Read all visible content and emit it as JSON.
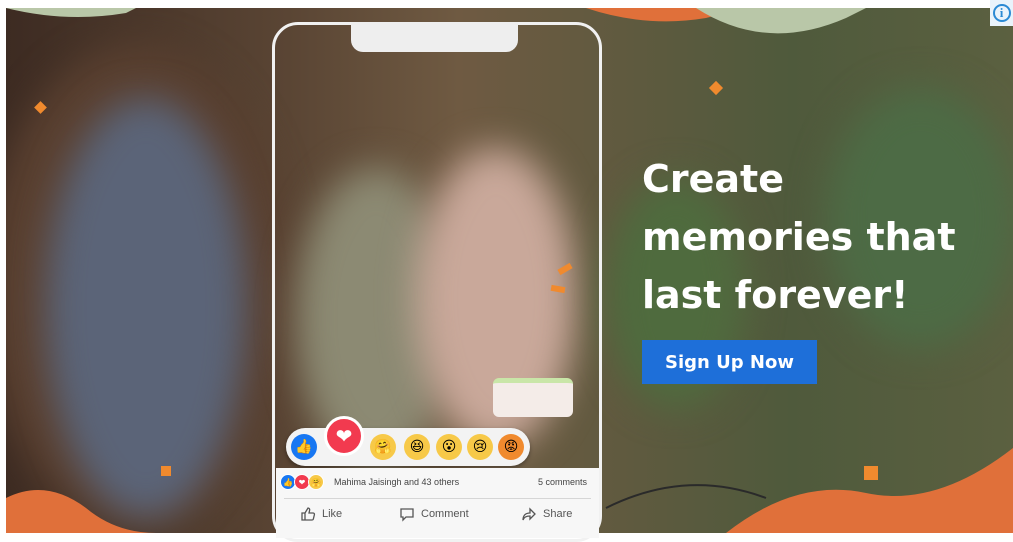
{
  "ad": {
    "headline_lines": [
      "Create",
      "memories that",
      "last forever!"
    ],
    "cta_label": "Sign Up Now",
    "info_badge": "i",
    "colors": {
      "cta": "#1e6fd9",
      "accent": "#f08a2e",
      "headline": "#ffffff"
    }
  },
  "post": {
    "reactions": [
      "like-icon",
      "love-icon",
      "care-icon",
      "haha-icon",
      "wow-icon",
      "sad-icon",
      "angry-icon"
    ],
    "reactions_summary": "Mahima Jaisingh and 43 others",
    "comments_count": "5 comments",
    "actions": {
      "like": "Like",
      "comment": "Comment",
      "share": "Share"
    }
  }
}
